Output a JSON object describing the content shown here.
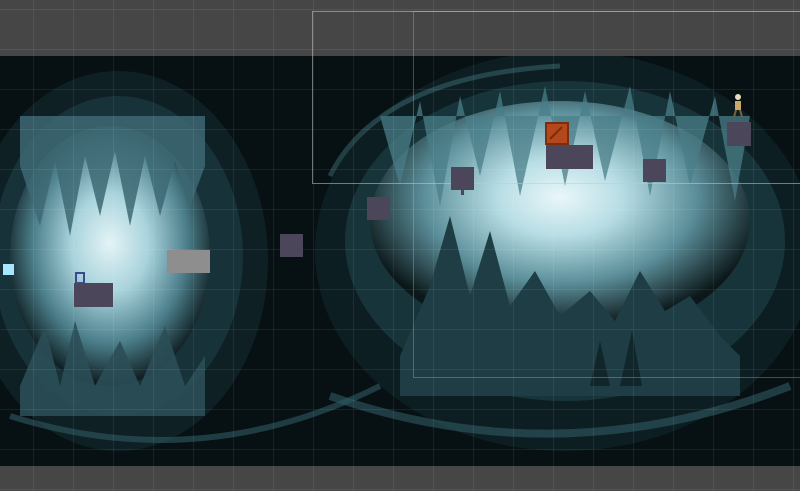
{
  "scene": {
    "background_color": "#464646",
    "backdrop_color": "#071012",
    "grid_color": "rgba(255,255,255,0.07)",
    "cave_light_color": "#cfe9ee",
    "cave_mid_color": "#7fb3c0",
    "cave_dark_color": "#1f3b42",
    "platform_color": "#4b4659",
    "gray_block_color": "#8e8e8e",
    "crate_color": "#b3481c",
    "light_block_color": "#a8e6ff",
    "icons": {
      "crate": "crate-icon",
      "character": "character-sprite-icon",
      "door": "door-outline-icon"
    }
  }
}
